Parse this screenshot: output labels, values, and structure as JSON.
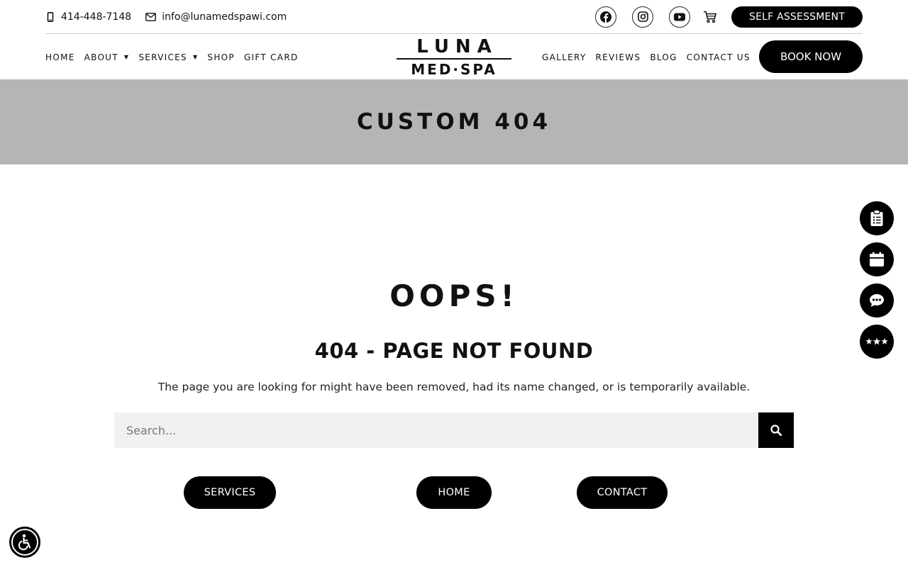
{
  "topbar": {
    "phone": "414-448-7148",
    "email": "info@lunamedspawi.com",
    "social": [
      "facebook-icon",
      "instagram-icon",
      "youtube-icon"
    ],
    "cart_icon": "cart-icon",
    "self_assessment_label": "SELF ASSESSMENT"
  },
  "nav": {
    "left_items": [
      {
        "label": "HOME"
      },
      {
        "label": "ABOUT",
        "dropdown": true
      },
      {
        "label": "SERVICES",
        "dropdown": true
      },
      {
        "label": "SHOP"
      },
      {
        "label": "GIFT CARD"
      }
    ],
    "right_items": [
      {
        "label": "GALLERY"
      },
      {
        "label": "REVIEWS"
      },
      {
        "label": "BLOG"
      },
      {
        "label": "CONTACT US"
      }
    ],
    "book_label": "BOOK NOW"
  },
  "logo": {
    "top": "LUNA",
    "bottom": "MED·SPA"
  },
  "banner": {
    "title": "CUSTOM 404"
  },
  "main": {
    "heading": "OOPS!",
    "subheading": "404 - PAGE NOT FOUND",
    "description": "The page you are looking for might have been removed, had its name changed, or is temporarily available.",
    "search_placeholder": "Search...",
    "buttons": {
      "services": "SERVICES",
      "home": "HOME",
      "contact": "CONTACT"
    }
  },
  "floating": [
    "clipboard-icon",
    "calendar-icon",
    "chat-icon",
    "stars-icon"
  ],
  "colors": {
    "accent": "#000000",
    "banner_bg": "#b5b5b5",
    "search_bg": "#f0f1f2"
  }
}
